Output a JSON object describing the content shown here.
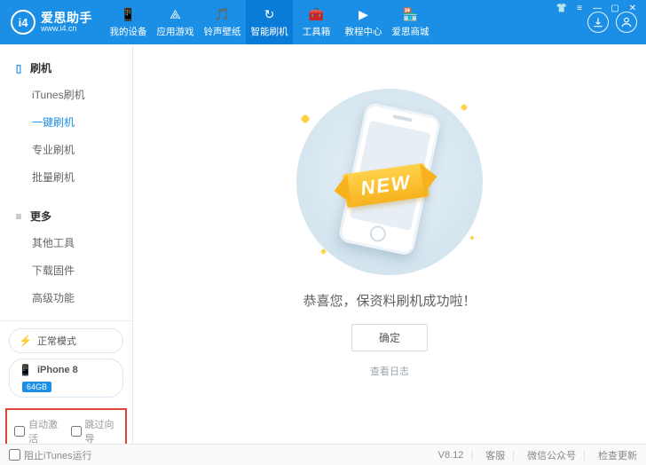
{
  "app": {
    "name": "爱思助手",
    "url": "www.i4.cn",
    "version": "V8.12"
  },
  "nav": {
    "items": [
      {
        "label": "我的设备",
        "icon": "📱"
      },
      {
        "label": "应用游戏",
        "icon": "⟁"
      },
      {
        "label": "铃声壁纸",
        "icon": "🎵"
      },
      {
        "label": "智能刷机",
        "icon": "↻",
        "active": true
      },
      {
        "label": "工具箱",
        "icon": "🧰"
      },
      {
        "label": "教程中心",
        "icon": "▶"
      },
      {
        "label": "爱思商城",
        "icon": "🏪"
      }
    ]
  },
  "sidebar": {
    "sections": [
      {
        "title": "刷机",
        "items": [
          {
            "label": "iTunes刷机"
          },
          {
            "label": "一键刷机",
            "active": true
          },
          {
            "label": "专业刷机"
          },
          {
            "label": "批量刷机"
          }
        ]
      },
      {
        "title": "更多",
        "items": [
          {
            "label": "其他工具"
          },
          {
            "label": "下载固件"
          },
          {
            "label": "高级功能"
          }
        ]
      }
    ],
    "mode": "正常模式",
    "device": {
      "name": "iPhone 8",
      "storage": "64GB"
    },
    "opts": {
      "auto_activate": "自动激活",
      "skip_guide": "跳过向导"
    }
  },
  "content": {
    "ribbon": "NEW",
    "success_text": "恭喜您，保资料刷机成功啦！",
    "ok": "确定",
    "view_log": "查看日志"
  },
  "footer": {
    "block_itunes": "阻止iTunes运行",
    "right": {
      "a": "客服",
      "b": "微信公众号",
      "c": "检查更新"
    }
  }
}
